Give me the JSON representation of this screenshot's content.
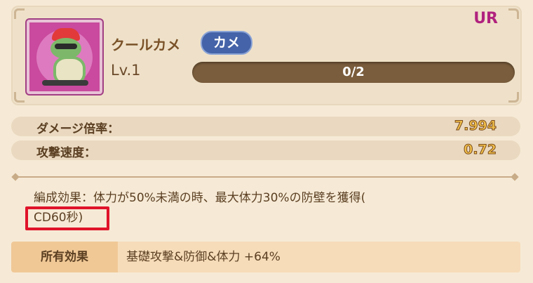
{
  "unit": {
    "rarity": "UR",
    "name": "クールカメ",
    "type_tag": "カメ",
    "level": "Lv.1",
    "progress_text": "0/2",
    "progress": 0
  },
  "stats": [
    {
      "label": "ダメージ倍率：",
      "value": "7.994"
    },
    {
      "label": "攻撃速度：",
      "value": "0.72"
    }
  ],
  "formation_effect": {
    "text": "編成効果：体力が50%未満の時、最大体力30%の防壁を獲得(",
    "cooldown": "CD60秒)"
  },
  "owned_effect": {
    "label": "所有効果",
    "value": "基礎攻撃&防御&体力 +64%"
  },
  "colors": {
    "rarity": "#b0227e",
    "tag_bg": "#4563a8",
    "highlight_box": "#e0132a"
  },
  "icons": {
    "portrait": "turtle-skater-portrait"
  }
}
